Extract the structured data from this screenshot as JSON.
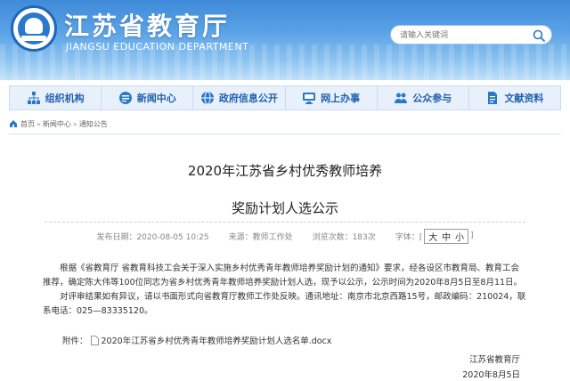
{
  "header": {
    "title": "江苏省教育厅",
    "subtitle": "JIANGSU EDUCATION DEPARTMENT",
    "search_placeholder": "请输入关键词"
  },
  "nav": {
    "items": [
      {
        "label": "组织机构",
        "icon": "org-chart-icon"
      },
      {
        "label": "新闻中心",
        "icon": "news-icon"
      },
      {
        "label": "政府信息公开",
        "icon": "globe-icon"
      },
      {
        "label": "网上办事",
        "icon": "monitor-icon"
      },
      {
        "label": "公众参与",
        "icon": "people-icon"
      },
      {
        "label": "文献资料",
        "icon": "document-icon"
      }
    ]
  },
  "breadcrumb": {
    "items": [
      "首页",
      "新闻中心",
      "通知公告"
    ],
    "separator": "»"
  },
  "article": {
    "title_line1": "2020年江苏省乡村优秀教师培养",
    "title_line2": "奖励计划人选公示",
    "meta": {
      "date": "发布日期：2020-08-05 10:25",
      "source": "来源：教师工作处",
      "views": "浏览次数：183次",
      "font_label": "字体：[",
      "font_large": "大",
      "font_medium": "中",
      "font_small": "小",
      "font_close": "]"
    },
    "paragraph1": "根据《省教育厅 省教育科技工会关于深入实施乡村优秀青年教师培养奖励计划的通知》要求，经各设区市教育局、教育工会推荐，确定陈大伟等100位同志为省乡村优秀青年教师培养奖励计划人选，现予以公示，公示时间为2020年8月5日至8月11日。",
    "paragraph2": "对评审结果如有异议，请以书面形式向省教育厅教师工作处反映。通讯地址：南京市北京西路15号，邮政编码：210024，联系电话：025—83335120。",
    "attachment_label": "附件：",
    "attachment_name": "2020年江苏省乡村优秀青年教师培养奖励计划人选名单.docx",
    "signature_org": "江苏省教育厅",
    "signature_date": "2020年8月5日"
  },
  "colors": {
    "header_blue": "#3f8ad9",
    "nav_text": "#1f5fae",
    "nav_bg": "#e8f1fb"
  }
}
